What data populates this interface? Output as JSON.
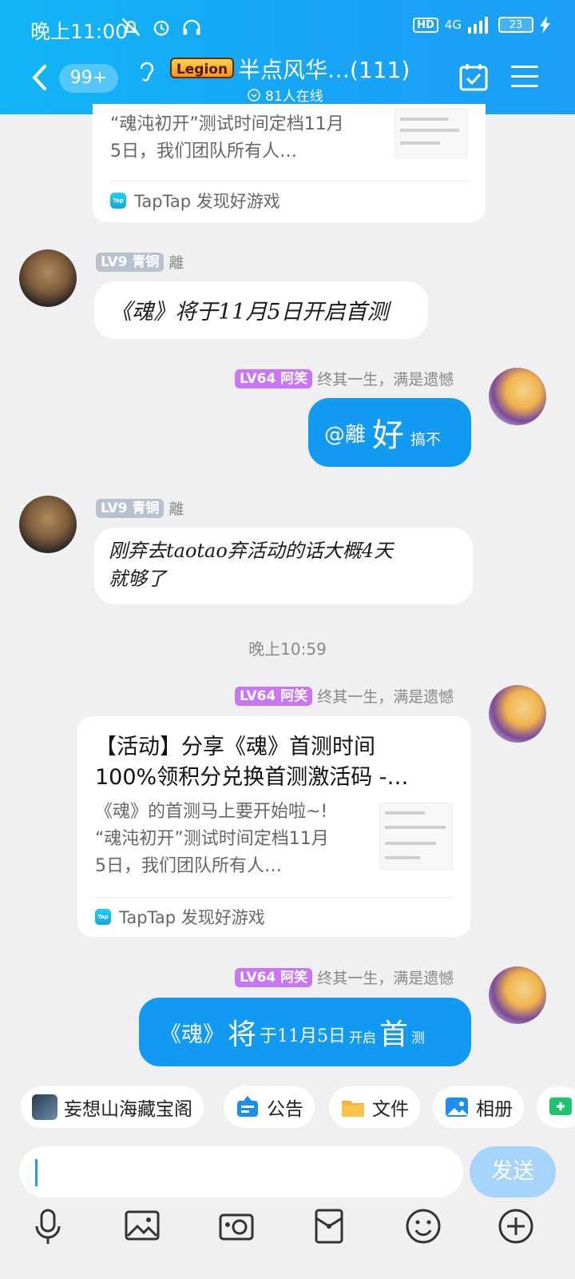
{
  "status_bar": {
    "time": "晚上11:00",
    "network": "4G",
    "hd": "HD",
    "battery": "23"
  },
  "header": {
    "unread_badge": "99+",
    "group_tag": "Legion",
    "title": "半点风华…(111)",
    "online": "81人在线"
  },
  "top_card": {
    "lead_line1": "“魂沌初开”测试时间定档11月",
    "lead_line2": "5日，我们团队所有人…",
    "source": "TapTap 发现好游戏"
  },
  "messages": [
    {
      "level": "LV9",
      "rank": "青铜",
      "name": "離",
      "text": "《魂》将于11月5日开启首测"
    },
    {
      "level": "LV64",
      "rank": "阿笑",
      "name": "终其一生，满是遗憾",
      "mention": "@離",
      "big": "好",
      "small": "搞不"
    },
    {
      "level": "LV9",
      "rank": "青铜",
      "name": "離",
      "text_line1": "刚弃去taotao弃活动的话大概4天",
      "text_line2": "就够了"
    },
    {
      "level": "LV64",
      "rank": "阿笑",
      "name": "终其一生，满是遗憾"
    },
    {
      "level": "LV64",
      "rank": "阿笑",
      "name": "终其一生，满是遗憾",
      "p1": "《魂》",
      "p2": "将",
      "p3": "于11月5日",
      "p4": "开启",
      "p5": "首",
      "p6": "测"
    }
  ],
  "timestamp": "晚上10:59",
  "share_card": {
    "title_line1": "【活动】分享《魂》首测时间",
    "title_line2": "100%领积分兑换首测激活码 -…",
    "lead_line1": "《魂》的首测马上要开始啦~!",
    "lead_line2": "“魂沌初开”测试时间定档11月",
    "lead_line3": "5日，我们团队所有人…",
    "source": "TapTap 发现好游戏"
  },
  "quick_chips": [
    {
      "label": "妄想山海藏宝阁",
      "icon": "game-avatar-icon"
    },
    {
      "label": "公告",
      "icon": "announcement-icon"
    },
    {
      "label": "文件",
      "icon": "folder-icon"
    },
    {
      "label": "相册",
      "icon": "album-icon"
    }
  ],
  "input": {
    "placeholder": "",
    "send_label": "发送"
  },
  "toolbar_icons": [
    "microphone-icon",
    "image-icon",
    "camera-icon",
    "red-packet-icon",
    "emoji-icon",
    "plus-icon"
  ],
  "colors": {
    "header": "#18a3f6",
    "bubble_right": "#129af2",
    "level_purple": "#c776f6",
    "level_bronze": "#b9c1d0",
    "send_disabled": "#a6d4fa"
  }
}
